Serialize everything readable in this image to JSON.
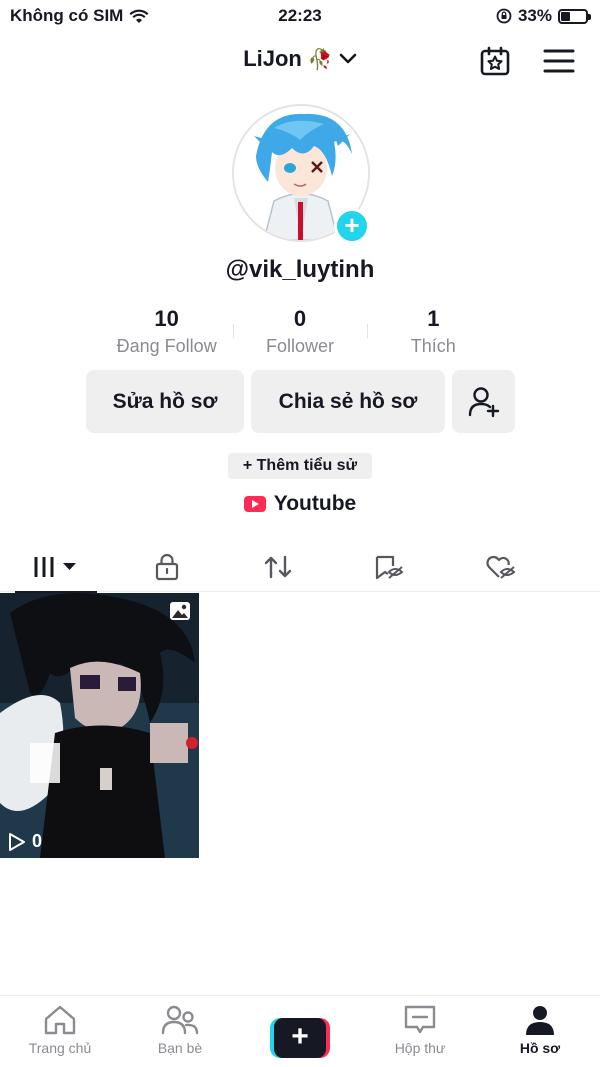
{
  "status_bar": {
    "carrier": "Không có SIM",
    "time": "22:23",
    "battery_percent": "33%",
    "battery_level": 0.33
  },
  "header": {
    "title": "LiJon",
    "title_emoji": "🥀",
    "icons": [
      "calendar-star-icon",
      "menu-icon"
    ]
  },
  "profile": {
    "username": "@vik_luytinh",
    "stats": [
      {
        "value": "10",
        "label": "Đang Follow"
      },
      {
        "value": "0",
        "label": "Follower"
      },
      {
        "value": "1",
        "label": "Thích"
      }
    ],
    "buttons": {
      "edit": "Sửa hồ sơ",
      "share": "Chia sẻ hồ sơ"
    },
    "add_bio": "+ Thêm tiểu sử",
    "link": "Youtube"
  },
  "tabs": [
    "videos-grid-icon",
    "lock-icon",
    "repost-icon",
    "saved-hidden-icon",
    "liked-hidden-icon"
  ],
  "videos": [
    {
      "views": "0"
    }
  ],
  "bottom_nav": {
    "items": [
      {
        "label": "Trang chủ",
        "icon": "home-icon"
      },
      {
        "label": "Bạn bè",
        "icon": "friends-icon"
      },
      {
        "label": "",
        "icon": "create-plus-icon"
      },
      {
        "label": "Hộp thư",
        "icon": "inbox-icon"
      },
      {
        "label": "Hồ sơ",
        "icon": "profile-icon"
      }
    ]
  },
  "colors": {
    "accent_cyan": "#20d5ec",
    "accent_pink": "#fe2c55",
    "text": "#161823",
    "muted": "#8a8b91"
  }
}
